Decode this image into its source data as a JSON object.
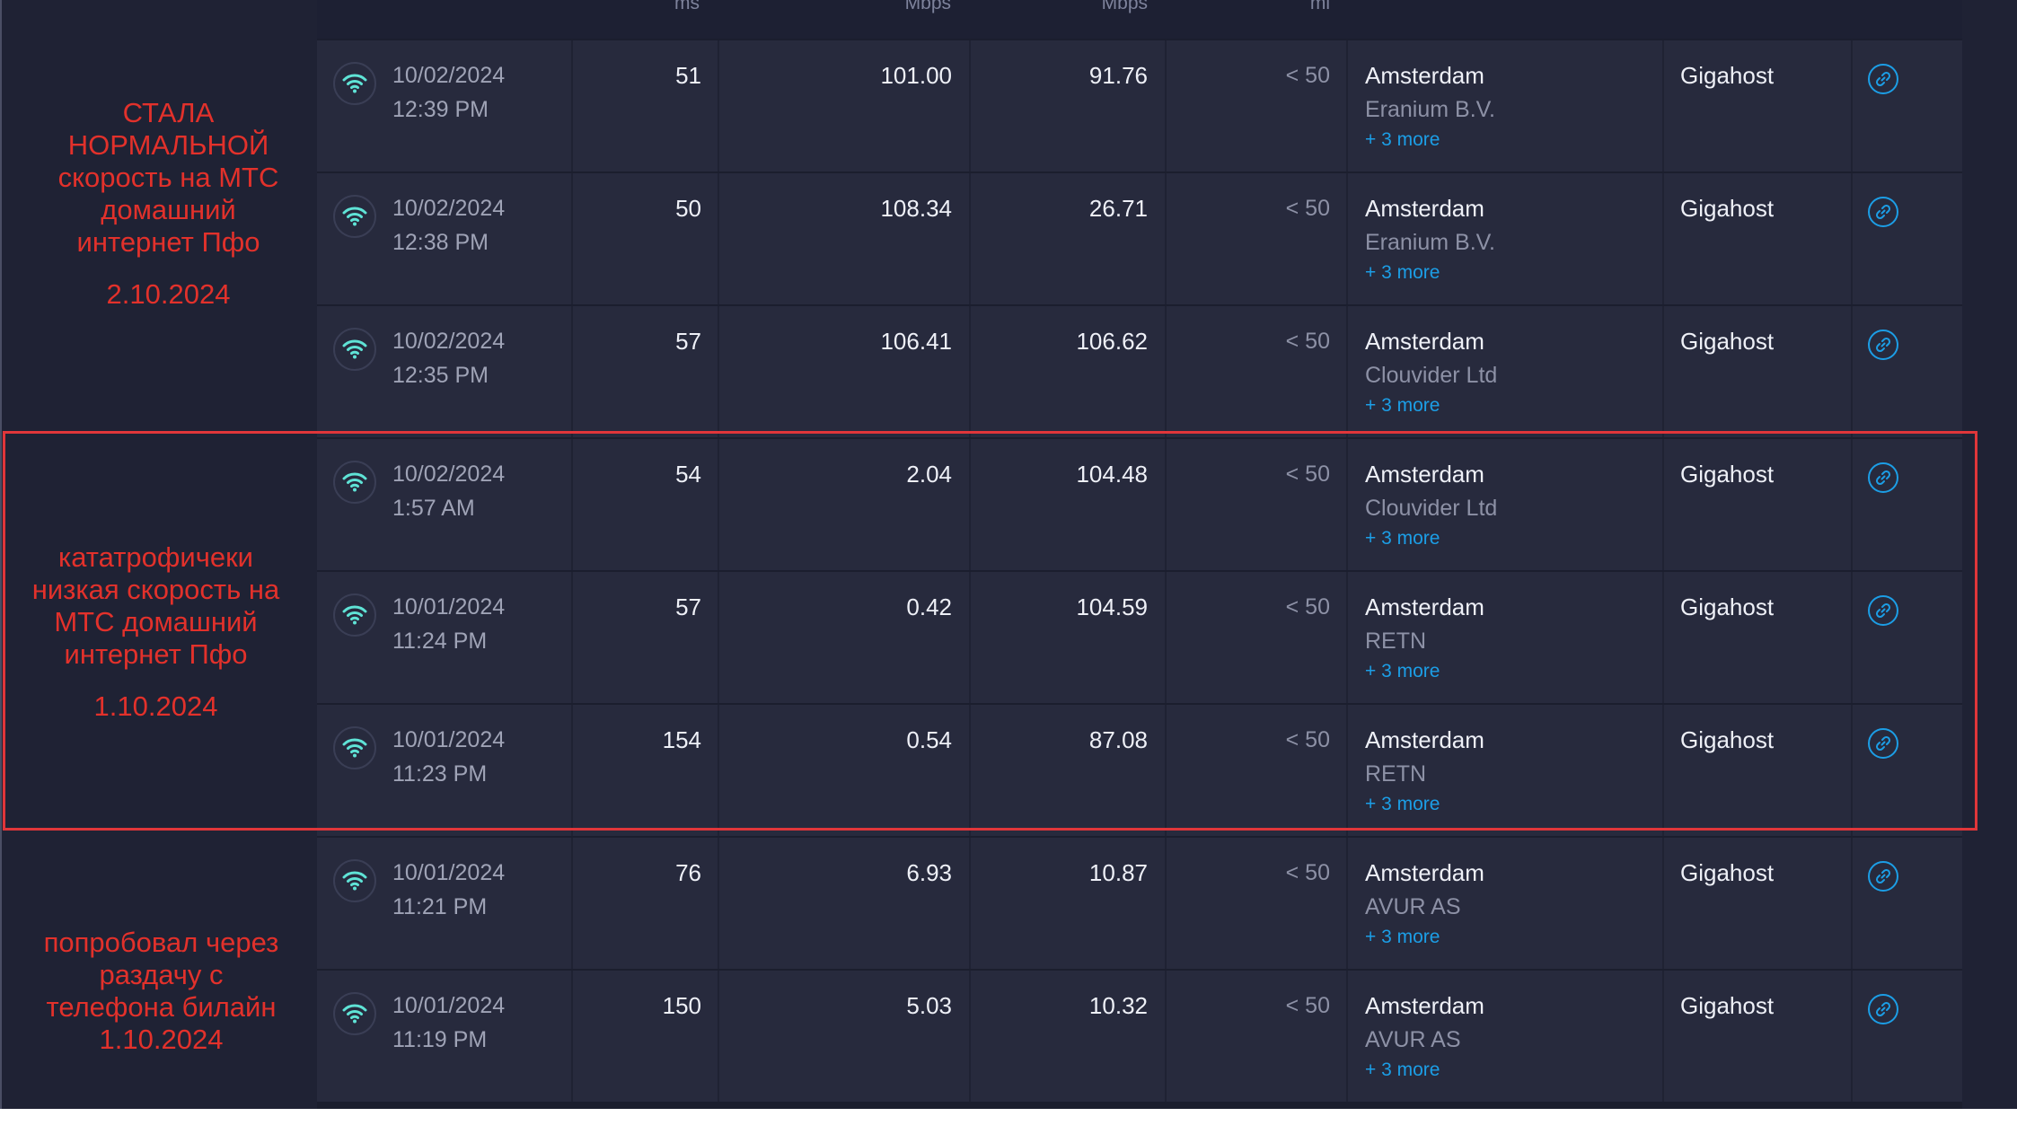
{
  "header": {
    "units": [
      "ms",
      "Mbps",
      "Mbps",
      "mi"
    ]
  },
  "rows": [
    {
      "date": "10/02/2024",
      "time": "12:39 PM",
      "ping": "51",
      "download": "101.00",
      "upload": "91.76",
      "distance": "< 50",
      "city": "Amsterdam",
      "isp": "Eranium B.V.",
      "more": "+ 3 more",
      "host": "Gigahost"
    },
    {
      "date": "10/02/2024",
      "time": "12:38 PM",
      "ping": "50",
      "download": "108.34",
      "upload": "26.71",
      "distance": "< 50",
      "city": "Amsterdam",
      "isp": "Eranium B.V.",
      "more": "+ 3 more",
      "host": "Gigahost"
    },
    {
      "date": "10/02/2024",
      "time": "12:35 PM",
      "ping": "57",
      "download": "106.41",
      "upload": "106.62",
      "distance": "< 50",
      "city": "Amsterdam",
      "isp": "Clouvider Ltd",
      "more": "+ 3 more",
      "host": "Gigahost"
    },
    {
      "date": "10/02/2024",
      "time": "1:57 AM",
      "ping": "54",
      "download": "2.04",
      "upload": "104.48",
      "distance": "< 50",
      "city": "Amsterdam",
      "isp": "Clouvider Ltd",
      "more": "+ 3 more",
      "host": "Gigahost"
    },
    {
      "date": "10/01/2024",
      "time": "11:24 PM",
      "ping": "57",
      "download": "0.42",
      "upload": "104.59",
      "distance": "< 50",
      "city": "Amsterdam",
      "isp": "RETN",
      "more": "+ 3 more",
      "host": "Gigahost"
    },
    {
      "date": "10/01/2024",
      "time": "11:23 PM",
      "ping": "154",
      "download": "0.54",
      "upload": "87.08",
      "distance": "< 50",
      "city": "Amsterdam",
      "isp": "RETN",
      "more": "+ 3 more",
      "host": "Gigahost"
    },
    {
      "date": "10/01/2024",
      "time": "11:21 PM",
      "ping": "76",
      "download": "6.93",
      "upload": "10.87",
      "distance": "< 50",
      "city": "Amsterdam",
      "isp": "AVUR AS",
      "more": "+ 3 more",
      "host": "Gigahost"
    },
    {
      "date": "10/01/2024",
      "time": "11:19 PM",
      "ping": "150",
      "download": "5.03",
      "upload": "10.32",
      "distance": "< 50",
      "city": "Amsterdam",
      "isp": "AVUR AS",
      "more": "+ 3 more",
      "host": "Gigahost"
    }
  ],
  "annotations": [
    {
      "lines": [
        "СТАЛА",
        "НОРМАЛЬНОЙ",
        "скорость на МТС",
        "домашний",
        "интернет Пфо"
      ],
      "date": "2.10.2024"
    },
    {
      "lines": [
        "кататрофичеки",
        "низкая скорость на",
        "МТС домашний",
        "интернет Пфо"
      ],
      "date": "1.10.2024"
    },
    {
      "lines": [
        "попробовал через",
        "раздачу с",
        "телефона билайн",
        "1.10.2024"
      ],
      "date": ""
    }
  ],
  "colors": {
    "background": "#1f2234",
    "row": "#272a3d",
    "accent_blue": "#1c9ee6",
    "wifi_teal": "#5fe3d6",
    "annotation_red": "#e2312b"
  },
  "icons": {
    "connection": "wifi-icon",
    "result_link": "link-icon"
  }
}
